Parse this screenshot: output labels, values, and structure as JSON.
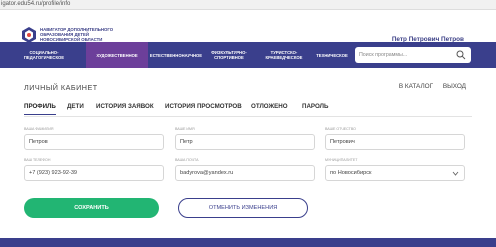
{
  "browser": {
    "url": "igator.edu54.ru/profile/info"
  },
  "header": {
    "brand_lines": [
      "НАВИГАТОР ДОПОЛНИТЕЛЬНОГО",
      "ОБРАЗОВАНИЯ ДЕТЕЙ",
      "НОВОСИБИРСКОЙ ОБЛАСТИ"
    ],
    "user_name": "Петр Петрович Петров"
  },
  "nav": {
    "items": [
      {
        "label": "СОЦИАЛЬНО-ПЕДАГОГИЧЕСКОЕ",
        "active": false
      },
      {
        "label": "ХУДОЖЕСТВЕННОЕ",
        "active": true
      },
      {
        "label": "ЕСТЕСТВЕННОНАУЧНОЕ",
        "active": false
      },
      {
        "label": "ФИЗКУЛЬТУРНО-СПОРТИВНОЕ",
        "active": false
      },
      {
        "label": "ТУРИСТСКО-КРАЕВЕДЧЕСКОЕ",
        "active": false
      },
      {
        "label": "ТЕХНИЧЕСКОЕ",
        "active": false
      }
    ],
    "search_placeholder": "Поиск программы..."
  },
  "page": {
    "title": "ЛИЧНЫЙ КАБИНЕТ",
    "catalog_link": "В КАТАЛОГ",
    "logout_link": "ВЫХОД"
  },
  "tabs": [
    {
      "label": "ПРОФИЛЬ",
      "active": true
    },
    {
      "label": "ДЕТИ",
      "active": false
    },
    {
      "label": "ИСТОРИЯ ЗАЯВОК",
      "active": false
    },
    {
      "label": "ИСТОРИЯ ПРОСМОТРОВ",
      "active": false
    },
    {
      "label": "ОТЛОЖЕНО",
      "active": false
    },
    {
      "label": "ПАРОЛЬ",
      "active": false
    }
  ],
  "form": {
    "last_name": {
      "label": "ВАША ФАМИЛИЯ",
      "value": "Петров"
    },
    "first_name": {
      "label": "ВАШЕ ИМЯ",
      "value": "Петр"
    },
    "patronymic": {
      "label": "ВАШЕ ОТЧЕСТВО",
      "value": "Петрович"
    },
    "phone": {
      "label": "ВАШ ТЕЛЕФОН",
      "value": "+7 (923) 923-92-39"
    },
    "email": {
      "label": "ВАША ПОЧТА",
      "value": "badyrova@yandex.ru"
    },
    "municipality": {
      "label": "МУНИЦИПАЛИТЕТ",
      "value": "по Новосибирск"
    }
  },
  "buttons": {
    "save": "СОХРАНИТЬ",
    "cancel": "ОТМЕНИТЬ ИЗМЕНЕНИЯ"
  },
  "colors": {
    "primary": "#3a3f8c",
    "active_nav": "#6c3f9a",
    "success": "#22b573"
  }
}
